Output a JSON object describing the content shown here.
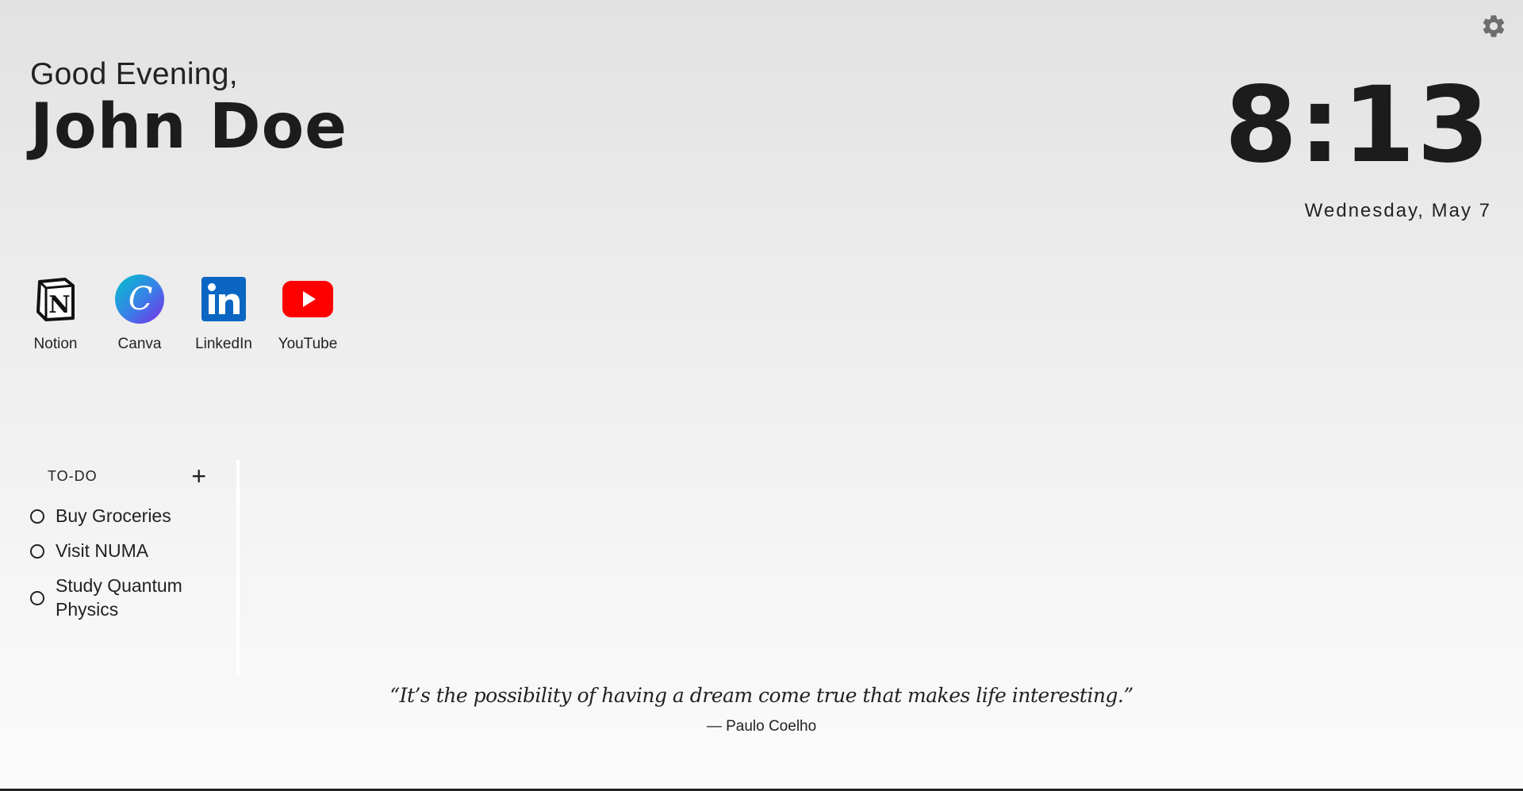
{
  "greeting": {
    "salutation": "Good Evening,",
    "name": "John Doe"
  },
  "clock": {
    "time": "8:13",
    "date": "Wednesday, May 7"
  },
  "settings": {
    "icon": "gear-icon"
  },
  "shortcuts": [
    {
      "label": "Notion",
      "icon": "notion-icon"
    },
    {
      "label": "Canva",
      "icon": "canva-icon"
    },
    {
      "label": "LinkedIn",
      "icon": "linkedin-icon"
    },
    {
      "label": "YouTube",
      "icon": "youtube-icon"
    }
  ],
  "todo": {
    "title": "TO-DO",
    "add_label": "+",
    "items": [
      {
        "text": "Buy Groceries"
      },
      {
        "text": "Visit NUMA"
      },
      {
        "text": "Study Quantum Physics"
      }
    ]
  },
  "quote": {
    "text": "“It’s the possibility of having a dream come true that makes life interesting.”",
    "author": "— Paulo Coelho"
  },
  "colors": {
    "text": "#1c1c1c",
    "youtube": "#ff0000",
    "linkedin": "#0a66c2",
    "canva_start": "#00c4cc",
    "canva_end": "#7d2ae8"
  }
}
